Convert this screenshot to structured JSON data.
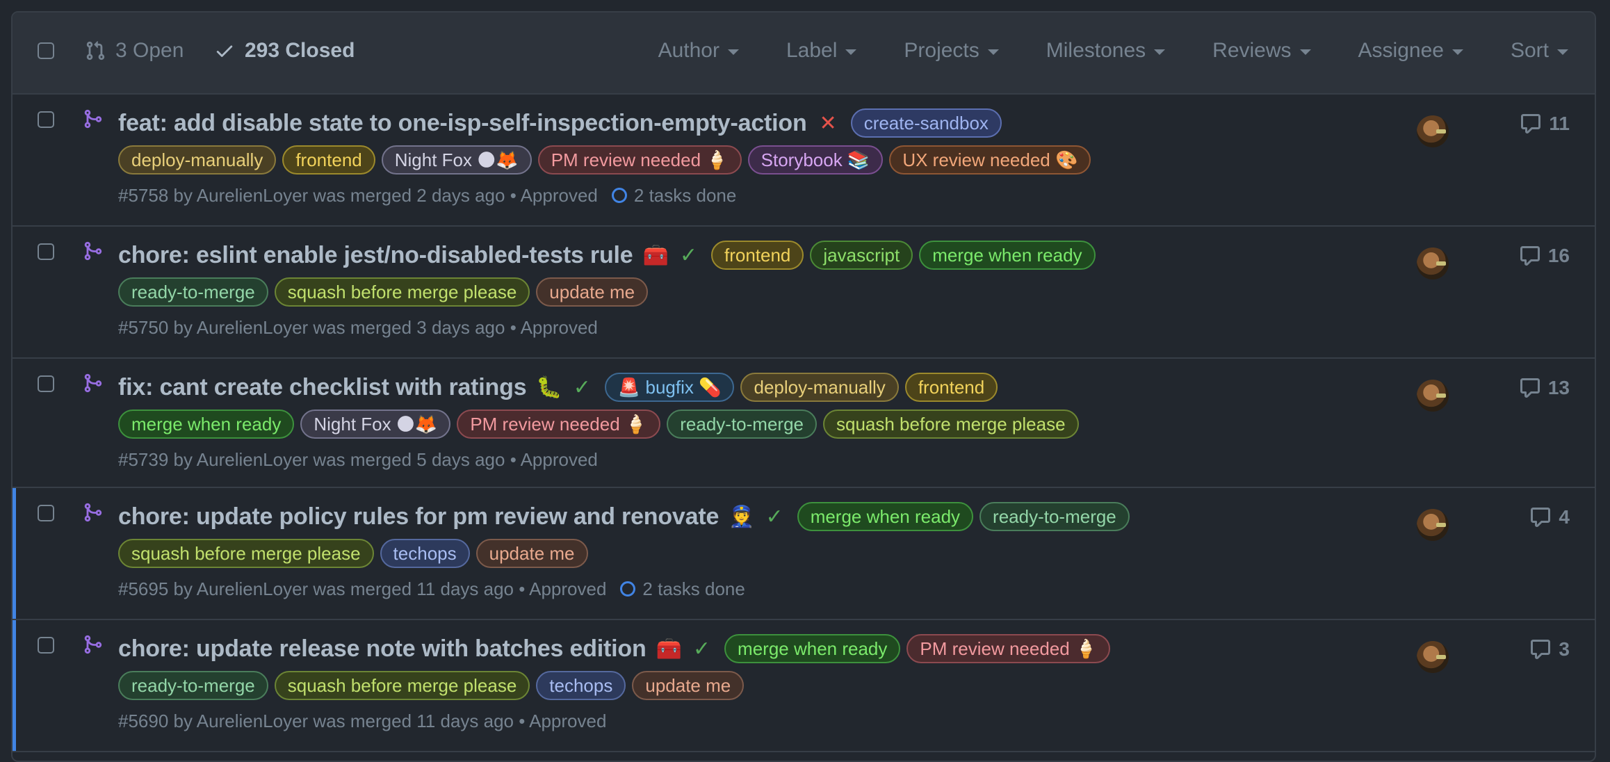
{
  "header": {
    "open_label": "3 Open",
    "closed_label": "293 Closed",
    "filters": [
      "Author",
      "Label",
      "Projects",
      "Milestones",
      "Reviews",
      "Assignee",
      "Sort"
    ]
  },
  "colors": {
    "background": "#22272e",
    "header_bg": "#2d333b",
    "border": "#373e47",
    "merged_purple": "#986ee2",
    "unread_blue": "#4184e4"
  },
  "label_styles": {
    "create-sandbox": {
      "bg": "#2e3a63",
      "border": "#5c6fb0",
      "fg": "#9fb4f0"
    },
    "deploy-manually": {
      "bg": "#4a4024",
      "border": "#8a7a3c",
      "fg": "#e8cf7a"
    },
    "frontend": {
      "bg": "#4d4419",
      "border": "#9c8a2c",
      "fg": "#f2d35b"
    },
    "night-fox": {
      "bg": "#3a3a48",
      "border": "#73738c",
      "fg": "#d4d4e4"
    },
    "pm-review": {
      "bg": "#4b2b2e",
      "border": "#8c4a50",
      "fg": "#f29a9f"
    },
    "storybook": {
      "bg": "#3d2b4a",
      "border": "#7a4f90",
      "fg": "#d7a6f2"
    },
    "ux-review": {
      "bg": "#4a3020",
      "border": "#8e5634",
      "fg": "#f2a77a"
    },
    "javascript": {
      "bg": "#25421c",
      "border": "#4c8a36",
      "fg": "#8ee06a"
    },
    "merge-when-ready": {
      "bg": "#1f4a1f",
      "border": "#3d913d",
      "fg": "#7bea6b"
    },
    "ready-to-merge": {
      "bg": "#24402f",
      "border": "#4a7d5b",
      "fg": "#93d6a8"
    },
    "squash": {
      "bg": "#36421c",
      "border": "#6c8535",
      "fg": "#c1e06d"
    },
    "update-me": {
      "bg": "#43312a",
      "border": "#7c5a4b",
      "fg": "#e8a98e"
    },
    "bugfix": {
      "bg": "#1f3447",
      "border": "#3d6891",
      "fg": "#7ec0f0"
    },
    "techops": {
      "bg": "#2d3a5c",
      "border": "#55699e",
      "fg": "#a9bdf2"
    }
  },
  "pull_requests": [
    {
      "title": "feat: add disable state to one-isp-self-inspection-empty-action",
      "emoji": "",
      "status": "failed",
      "status_glyph": "✕",
      "line1_labels": [
        {
          "text": "create-sandbox",
          "style": "create-sandbox"
        }
      ],
      "line2_labels": [
        {
          "text": "deploy-manually",
          "style": "deploy-manually"
        },
        {
          "text": "frontend",
          "style": "frontend"
        },
        {
          "text": "Night Fox 🌑🦊",
          "style": "night-fox"
        },
        {
          "text": "PM review needed 🍦",
          "style": "pm-review"
        },
        {
          "text": "Storybook 📚",
          "style": "storybook"
        },
        {
          "text": "UX review needed 🎨",
          "style": "ux-review"
        }
      ],
      "meta": "#5758 by AurelienLoyer was merged 2 days ago • Approved",
      "tasks": "2 tasks done",
      "comments": "11",
      "unread": false
    },
    {
      "title": "chore: eslint enable jest/no-disabled-tests rule",
      "emoji": "🧰",
      "status": "success",
      "status_glyph": "✓",
      "line1_labels": [
        {
          "text": "frontend",
          "style": "frontend"
        },
        {
          "text": "javascript",
          "style": "javascript"
        },
        {
          "text": "merge when ready",
          "style": "merge-when-ready"
        }
      ],
      "line2_labels": [
        {
          "text": "ready-to-merge",
          "style": "ready-to-merge"
        },
        {
          "text": "squash before merge please",
          "style": "squash"
        },
        {
          "text": "update me",
          "style": "update-me"
        }
      ],
      "meta": "#5750 by AurelienLoyer was merged 3 days ago • Approved",
      "tasks": "",
      "comments": "16",
      "unread": false
    },
    {
      "title": "fix: cant create checklist with ratings",
      "emoji": "🐛",
      "status": "success",
      "status_glyph": "✓",
      "line1_labels": [
        {
          "text": "🚨 bugfix 💊",
          "style": "bugfix"
        },
        {
          "text": "deploy-manually",
          "style": "deploy-manually"
        },
        {
          "text": "frontend",
          "style": "frontend"
        }
      ],
      "line2_labels": [
        {
          "text": "merge when ready",
          "style": "merge-when-ready"
        },
        {
          "text": "Night Fox 🌑🦊",
          "style": "night-fox"
        },
        {
          "text": "PM review needed 🍦",
          "style": "pm-review"
        },
        {
          "text": "ready-to-merge",
          "style": "ready-to-merge"
        },
        {
          "text": "squash before merge please",
          "style": "squash"
        }
      ],
      "meta": "#5739 by AurelienLoyer was merged 5 days ago • Approved",
      "tasks": "",
      "comments": "13",
      "unread": false
    },
    {
      "title": "chore: update policy rules for pm review and renovate",
      "emoji": "👮",
      "status": "success",
      "status_glyph": "✓",
      "line1_labels": [
        {
          "text": "merge when ready",
          "style": "merge-when-ready"
        },
        {
          "text": "ready-to-merge",
          "style": "ready-to-merge"
        }
      ],
      "line2_labels": [
        {
          "text": "squash before merge please",
          "style": "squash"
        },
        {
          "text": "techops",
          "style": "techops"
        },
        {
          "text": "update me",
          "style": "update-me"
        }
      ],
      "meta": "#5695 by AurelienLoyer was merged 11 days ago • Approved",
      "tasks": "2 tasks done",
      "comments": "4",
      "unread": true
    },
    {
      "title": "chore: update release note with batches edition",
      "emoji": "🧰",
      "status": "success",
      "status_glyph": "✓",
      "line1_labels": [
        {
          "text": "merge when ready",
          "style": "merge-when-ready"
        },
        {
          "text": "PM review needed 🍦",
          "style": "pm-review"
        }
      ],
      "line2_labels": [
        {
          "text": "ready-to-merge",
          "style": "ready-to-merge"
        },
        {
          "text": "squash before merge please",
          "style": "squash"
        },
        {
          "text": "techops",
          "style": "techops"
        },
        {
          "text": "update me",
          "style": "update-me"
        }
      ],
      "meta": "#5690 by AurelienLoyer was merged 11 days ago • Approved",
      "tasks": "",
      "comments": "3",
      "unread": true
    }
  ]
}
